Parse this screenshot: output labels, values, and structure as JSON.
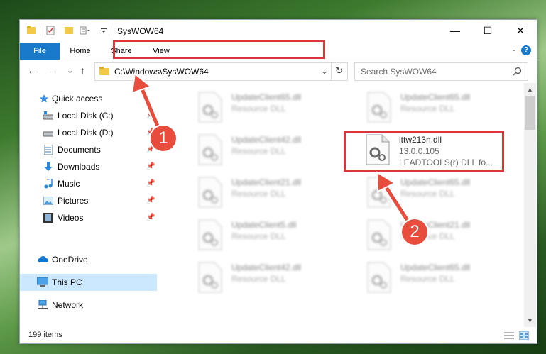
{
  "window": {
    "title": "SysWOW64",
    "controls": {
      "minimize": "—",
      "maximize": "☐",
      "close": "✕"
    }
  },
  "ribbon": {
    "tabs": [
      "File",
      "Home",
      "Share",
      "View"
    ],
    "help": "?",
    "expand": "⌄"
  },
  "nav": {
    "back": "←",
    "forward": "→",
    "recent": "⌄",
    "up": "↑",
    "address": "C:\\Windows\\SysWOW64",
    "address_dropdown": "⌄",
    "refresh": "↻",
    "search_placeholder": "Search SysWOW64"
  },
  "sidebar": {
    "items": [
      {
        "label": "Quick access",
        "icon": "star-icon",
        "pinned": false
      },
      {
        "label": "Local Disk (C:)",
        "icon": "drive-icon",
        "pinned": true
      },
      {
        "label": "Local Disk (D:)",
        "icon": "drive-icon",
        "pinned": true
      },
      {
        "label": "Documents",
        "icon": "documents-icon",
        "pinned": true
      },
      {
        "label": "Downloads",
        "icon": "downloads-icon",
        "pinned": true
      },
      {
        "label": "Music",
        "icon": "music-icon",
        "pinned": true
      },
      {
        "label": "Pictures",
        "icon": "pictures-icon",
        "pinned": true
      },
      {
        "label": "Videos",
        "icon": "videos-icon",
        "pinned": true
      },
      {
        "label": "OneDrive",
        "icon": "cloud-icon",
        "pinned": false
      },
      {
        "label": "This PC",
        "icon": "computer-icon",
        "pinned": false,
        "selected": true
      },
      {
        "label": "Network",
        "icon": "network-icon",
        "pinned": false
      }
    ]
  },
  "files": [
    {
      "name": "UpdateClient65.dll",
      "type": "Resource DLL"
    },
    {
      "name": "UpdateClient65.dll",
      "type": "Resource DLL"
    },
    {
      "name": "UpdateClient42.dll",
      "type": "Resource DLL"
    },
    {
      "name": "lttw213n.dll",
      "version": "13.0.0.105",
      "description": "LEADTOOLS(r) DLL fo..."
    },
    {
      "name": "UpdateClient21.dll",
      "type": "Resource DLL"
    },
    {
      "name": "UpdateClient65.dll",
      "type": "Resource DLL"
    },
    {
      "name": "UpdateClient5.dll",
      "type": "Resource DLL"
    },
    {
      "name": "UpdateClient21.dll",
      "type": "Resource DLL"
    },
    {
      "name": "UpdateClient42.dll",
      "type": "Resource DLL"
    },
    {
      "name": "UpdateClient65.dll",
      "type": "Resource DLL"
    }
  ],
  "status": {
    "item_count": "199 items"
  },
  "markers": [
    "1",
    "2"
  ],
  "colors": {
    "accent": "#1979ca",
    "highlight": "#d9383a",
    "marker": "#e84c3d",
    "selected": "#cce8ff"
  }
}
